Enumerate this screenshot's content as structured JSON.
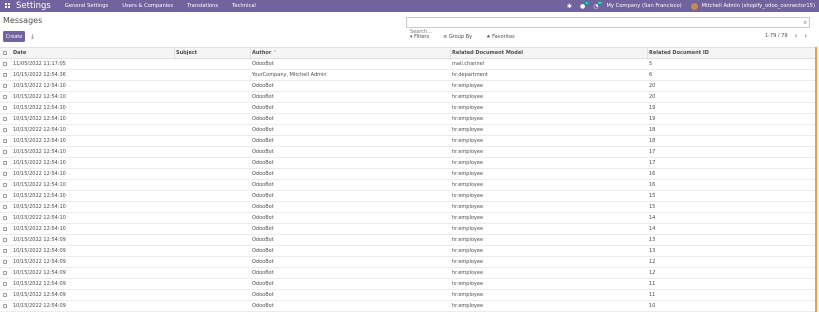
{
  "navbar": {
    "brand": "Settings",
    "menus": [
      "General Settings",
      "Users & Companies",
      "Translations",
      "Technical"
    ],
    "chat_badge": "5",
    "activity_badge": "37",
    "company": "My Company (San Francisco)",
    "user": "Mitchell Admin (shopify_odoo_connector15)"
  },
  "control": {
    "title": "Messages",
    "search_placeholder": "Search...",
    "create_label": "Create",
    "filters_label": "Filters",
    "groupby_label": "Group By",
    "favorites_label": "Favorites",
    "pager": "1-79 / 79"
  },
  "table": {
    "headers": {
      "date": "Date",
      "subject": "Subject",
      "author": "Author",
      "model": "Related Document Model",
      "docid": "Related Document ID"
    },
    "rows": [
      {
        "date": "11/05/2022 11:17:05",
        "subject": "",
        "author": "OdooBot",
        "model": "mail.channel",
        "docid": "5"
      },
      {
        "date": "10/15/2022 12:54:36",
        "subject": "",
        "author": "YourCompany, Mitchell Admin",
        "model": "hr.department",
        "docid": "6"
      },
      {
        "date": "10/15/2022 12:54:10",
        "subject": "",
        "author": "OdooBot",
        "model": "hr.employee",
        "docid": "20"
      },
      {
        "date": "10/15/2022 12:54:10",
        "subject": "",
        "author": "OdooBot",
        "model": "hr.employee",
        "docid": "20"
      },
      {
        "date": "10/15/2022 12:54:10",
        "subject": "",
        "author": "OdooBot",
        "model": "hr.employee",
        "docid": "19"
      },
      {
        "date": "10/15/2022 12:54:10",
        "subject": "",
        "author": "OdooBot",
        "model": "hr.employee",
        "docid": "19"
      },
      {
        "date": "10/15/2022 12:54:10",
        "subject": "",
        "author": "OdooBot",
        "model": "hr.employee",
        "docid": "18"
      },
      {
        "date": "10/15/2022 12:54:10",
        "subject": "",
        "author": "OdooBot",
        "model": "hr.employee",
        "docid": "18"
      },
      {
        "date": "10/15/2022 12:54:10",
        "subject": "",
        "author": "OdooBot",
        "model": "hr.employee",
        "docid": "17"
      },
      {
        "date": "10/15/2022 12:54:10",
        "subject": "",
        "author": "OdooBot",
        "model": "hr.employee",
        "docid": "17"
      },
      {
        "date": "10/15/2022 12:54:10",
        "subject": "",
        "author": "OdooBot",
        "model": "hr.employee",
        "docid": "16"
      },
      {
        "date": "10/15/2022 12:54:10",
        "subject": "",
        "author": "OdooBot",
        "model": "hr.employee",
        "docid": "16"
      },
      {
        "date": "10/15/2022 12:54:10",
        "subject": "",
        "author": "OdooBot",
        "model": "hr.employee",
        "docid": "15"
      },
      {
        "date": "10/15/2022 12:54:10",
        "subject": "",
        "author": "OdooBot",
        "model": "hr.employee",
        "docid": "15"
      },
      {
        "date": "10/15/2022 12:54:10",
        "subject": "",
        "author": "OdooBot",
        "model": "hr.employee",
        "docid": "14"
      },
      {
        "date": "10/15/2022 12:54:10",
        "subject": "",
        "author": "OdooBot",
        "model": "hr.employee",
        "docid": "14"
      },
      {
        "date": "10/15/2022 12:54:09",
        "subject": "",
        "author": "OdooBot",
        "model": "hr.employee",
        "docid": "13"
      },
      {
        "date": "10/15/2022 12:54:09",
        "subject": "",
        "author": "OdooBot",
        "model": "hr.employee",
        "docid": "13"
      },
      {
        "date": "10/15/2022 12:54:09",
        "subject": "",
        "author": "OdooBot",
        "model": "hr.employee",
        "docid": "12"
      },
      {
        "date": "10/15/2022 12:54:09",
        "subject": "",
        "author": "OdooBot",
        "model": "hr.employee",
        "docid": "12"
      },
      {
        "date": "10/15/2022 12:54:09",
        "subject": "",
        "author": "OdooBot",
        "model": "hr.employee",
        "docid": "11"
      },
      {
        "date": "10/15/2022 12:54:09",
        "subject": "",
        "author": "OdooBot",
        "model": "hr.employee",
        "docid": "11"
      },
      {
        "date": "10/15/2022 12:54:09",
        "subject": "",
        "author": "OdooBot",
        "model": "hr.employee",
        "docid": "10"
      }
    ]
  }
}
